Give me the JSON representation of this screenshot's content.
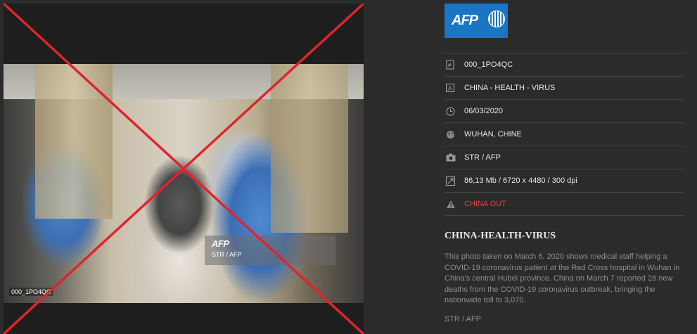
{
  "photo": {
    "id": "000_1PO4QC",
    "watermark_logo": "AFP",
    "watermark_credit": "STR / AFP",
    "cross_color": "#e0242b"
  },
  "brand": {
    "logo": "AFP",
    "color": "#1a76c4"
  },
  "metadata": [
    {
      "icon": "hash-icon",
      "value": "000_1PO4QC"
    },
    {
      "icon": "title-icon",
      "value": "CHINA - HEALTH - VIRUS"
    },
    {
      "icon": "clock-icon",
      "value": "06/03/2020"
    },
    {
      "icon": "globe-icon",
      "value": "WUHAN, CHINE"
    },
    {
      "icon": "camera-icon",
      "value": "STR / AFP"
    },
    {
      "icon": "resize-icon",
      "value": "86,13 Mb / 6720 x 4480 / 300 dpi"
    },
    {
      "icon": "warning-icon",
      "value": "CHINA OUT"
    }
  ],
  "caption": {
    "title": "CHINA-HEALTH-VIRUS",
    "body": "This photo taken on March 6, 2020 shows medical staff helping a COVID-19 coronavirus patient at the Red Cross hospital in Wuhan in China's central Hubei province. China on March 7 reported 28 new deaths from the COVID-19 coronavirus outbreak, bringing the nationwide toll to 3,070.",
    "credit": "STR / AFP"
  },
  "colors": {
    "warning": "#dd4444",
    "background": "#2b2b2b"
  }
}
